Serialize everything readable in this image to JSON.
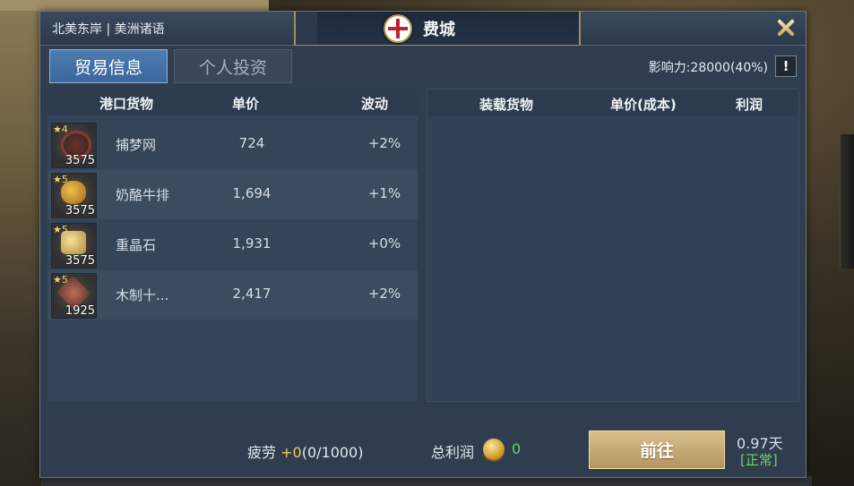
{
  "header": {
    "region": "北美东岸 | 美洲诸语",
    "city": "费城",
    "flag_icon": "red-cross-flag-icon",
    "close_icon": "close-icon"
  },
  "tabs": [
    {
      "label": "贸易信息",
      "active": true
    },
    {
      "label": "个人投资",
      "active": false
    }
  ],
  "influence": "影响力:28000(40%)",
  "info_button": "!",
  "port_goods": {
    "columns": [
      "港口货物",
      "单价",
      "波动"
    ],
    "rows": [
      {
        "stars": "★4",
        "qty": "3575",
        "name": "捕梦网",
        "price": "724",
        "change": "+2%",
        "icon": "dreamcatcher-icon"
      },
      {
        "stars": "★5",
        "qty": "3575",
        "name": "奶酪牛排",
        "price": "1,694",
        "change": "+1%",
        "icon": "cheese-steak-icon"
      },
      {
        "stars": "★5",
        "qty": "3575",
        "name": "重晶石",
        "price": "1,931",
        "change": "+0%",
        "icon": "barite-icon"
      },
      {
        "stars": "★5",
        "qty": "1925",
        "name": "木制十...",
        "price": "2,417",
        "change": "+2%",
        "icon": "wooden-cross-icon"
      }
    ]
  },
  "cargo": {
    "columns": [
      "装载货物",
      "单价(成本)",
      "利润"
    ],
    "rows": []
  },
  "footer": {
    "fatigue_label": "疲劳",
    "fatigue_plus": "+0",
    "fatigue_value": "(0/1000)",
    "profit_label": "总利润",
    "profit_value": "0",
    "go_label": "前往",
    "days": "0.97天",
    "status": "[正常]"
  },
  "colors": {
    "accent_blue": "#3a679c",
    "gold": "#d9c08b",
    "green": "#6fd25e"
  }
}
